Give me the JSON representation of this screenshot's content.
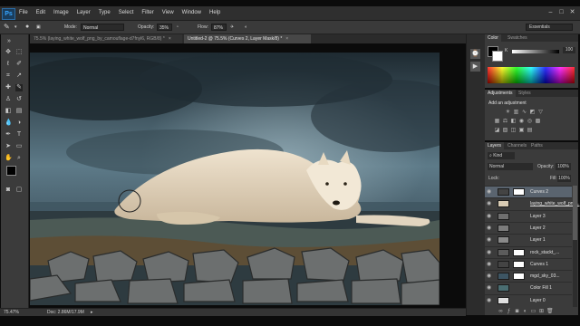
{
  "app": {
    "logo": "Ps"
  },
  "menubar": {
    "items": [
      "File",
      "Edit",
      "Image",
      "Layer",
      "Type",
      "Select",
      "Filter",
      "View",
      "Window",
      "Help"
    ]
  },
  "window_controls": {
    "minimize": "–",
    "maximize": "□",
    "close": "✕"
  },
  "options_bar": {
    "mode_label": "Mode:",
    "mode_value": "Normal",
    "opacity_label": "Opacity:",
    "opacity_value": "35%",
    "flow_label": "Flow:",
    "flow_value": "87%",
    "workspace": "Essentials"
  },
  "document_tabs": [
    {
      "label": "75.5% (laying_white_wolf_png_by_camouflage-d7fnyl6, RGB/8) *",
      "active": false
    },
    {
      "label": "Untitled-2 @ 75.5% (Curves 2, Layer Mask/8) *",
      "active": true
    }
  ],
  "status_bar": {
    "zoom": "75.47%",
    "doc": "Doc: 2.86M/17.9M"
  },
  "color_panel": {
    "tabs": [
      "Color",
      "Swatches"
    ],
    "k_label": "K",
    "k_value": "100",
    "foreground": "#000000",
    "background": "#ffffff"
  },
  "adjustments_panel": {
    "tabs": [
      "Adjustments",
      "Styles"
    ],
    "title": "Add an adjustment"
  },
  "layers_panel": {
    "tabs": [
      "Layers",
      "Channels",
      "Paths"
    ],
    "kind_label": "Kind",
    "blend_mode": "Normal",
    "opacity_label": "Opacity:",
    "opacity_value": "100%",
    "lock_label": "Lock:",
    "fill_label": "Fill:",
    "fill_value": "100%",
    "layers": [
      {
        "name": "Curves 2",
        "selected": true,
        "underline": false
      },
      {
        "name": "laying_white_wolf_png...",
        "selected": false,
        "underline": true
      },
      {
        "name": "Layer 3",
        "selected": false,
        "underline": false
      },
      {
        "name": "Layer 2",
        "selected": false,
        "underline": false
      },
      {
        "name": "Layer 1",
        "selected": false,
        "underline": false
      },
      {
        "name": "rock_stackt_...",
        "selected": false,
        "underline": false
      },
      {
        "name": "Curves 1",
        "selected": false,
        "underline": false
      },
      {
        "name": "mgd_sky_03...",
        "selected": false,
        "underline": false
      },
      {
        "name": "Color Fill 1",
        "selected": false,
        "underline": false
      },
      {
        "name": "Layer 0",
        "selected": false,
        "underline": false
      }
    ]
  },
  "colors": {
    "accent_selection": "#5a646f",
    "panel_bg": "#3b3b3b",
    "ps_blue": "#38a6ff"
  }
}
